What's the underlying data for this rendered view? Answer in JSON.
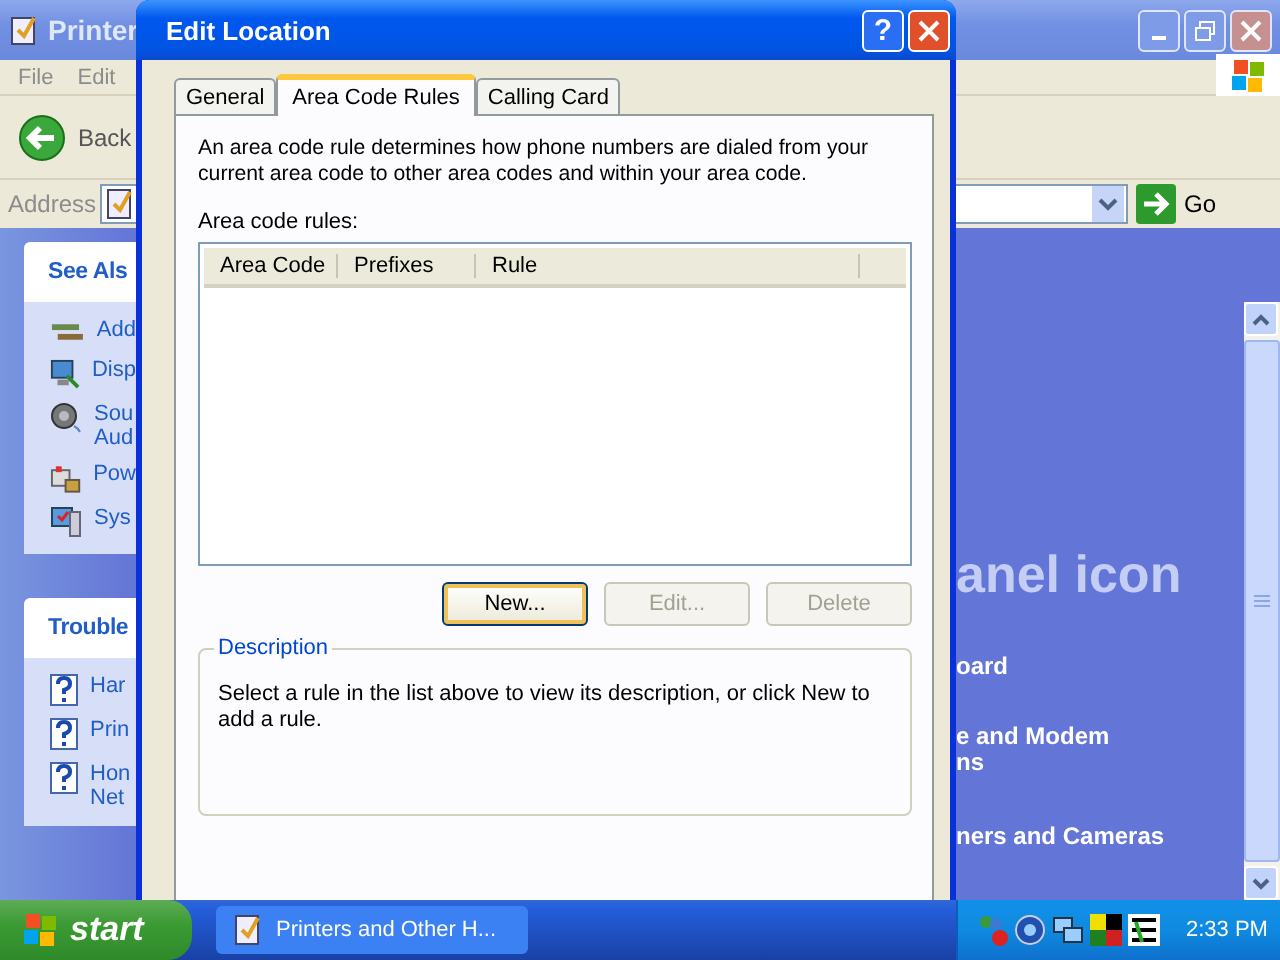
{
  "background_window": {
    "title": "Printer",
    "menu": [
      "File",
      "Edit"
    ],
    "toolbar": {
      "back": "Back"
    },
    "address": {
      "label": "Address",
      "go": "Go"
    },
    "see_also": {
      "title": "See Als",
      "items": [
        {
          "kind": "network",
          "lines": [
            "Add"
          ]
        },
        {
          "kind": "display",
          "lines": [
            "Disp"
          ]
        },
        {
          "kind": "sound",
          "lines": [
            "Sou",
            "Aud"
          ]
        },
        {
          "kind": "power",
          "lines": [
            "Pow"
          ]
        },
        {
          "kind": "system",
          "lines": [
            "Sys"
          ]
        }
      ]
    },
    "troubleshooters": {
      "title": "Trouble",
      "items": [
        {
          "kind": "help",
          "lines": [
            "Har"
          ]
        },
        {
          "kind": "help",
          "lines": [
            "Prin"
          ]
        },
        {
          "kind": "help",
          "lines": [
            "Hon",
            "Net"
          ]
        }
      ]
    },
    "content": {
      "heading": "anel icon",
      "items": [
        {
          "lines": [
            "oard"
          ]
        },
        {
          "lines": [
            "e and Modem",
            "ns"
          ]
        },
        {
          "lines": [
            "ners and Cameras"
          ]
        }
      ]
    }
  },
  "dialog": {
    "title": "Edit Location",
    "help": "?",
    "tabs": [
      {
        "label": "General",
        "selected": false
      },
      {
        "label": "Area Code Rules",
        "selected": true
      },
      {
        "label": "Calling Card",
        "selected": false
      }
    ],
    "intro": "An area code rule determines how phone numbers are dialed from your current area code to other area codes and within your area code.",
    "list_label": "Area code rules:",
    "columns": [
      "Area Code",
      "Prefixes",
      "Rule"
    ],
    "buttons": [
      {
        "label": "New...",
        "disabled": false,
        "default": true
      },
      {
        "label": "Edit...",
        "disabled": true,
        "default": false
      },
      {
        "label": "Delete",
        "disabled": true,
        "default": false
      }
    ],
    "group": {
      "title": "Description",
      "text": "Select a rule in the list above to view its description, or click New to add a rule."
    }
  },
  "taskbar": {
    "start": "start",
    "tasks": [
      {
        "label": "Printers and Other H..."
      }
    ],
    "clock": "2:33 PM"
  }
}
